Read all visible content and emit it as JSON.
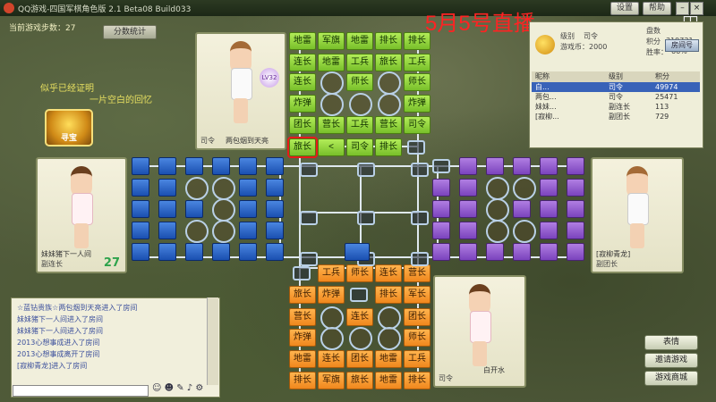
{
  "window": {
    "title": "QQ游戏-四国军棋角色版 2.1 Beta08 Build033",
    "top_buttons": [
      "设置",
      "帮助"
    ]
  },
  "game": {
    "steps_label": "当前游戏步数：27",
    "stats_button": "分数统计"
  },
  "slogan": {
    "line1": "似乎已经证明",
    "line2": "一片空白的回忆"
  },
  "treasure": {
    "label": "寻宝"
  },
  "live_banner": "5月5号直播",
  "players": {
    "top": {
      "name": "两包烟到天亮",
      "rank": "司令",
      "level": "LV32"
    },
    "left": {
      "name": "妹妹猪下一人间",
      "rank": "副连长",
      "gold": "27"
    },
    "right": {
      "name": "[寂柳青龙]",
      "rank": "副团长"
    },
    "bottom": {
      "name": "白开水",
      "rank": "司令"
    }
  },
  "info": {
    "labels": [
      "级别",
      "司令",
      "游戏币：2000"
    ],
    "right_labels": [
      "盘数",
      "积分",
      "胜率："
    ],
    "score": "319731",
    "win_rate": "66%",
    "room_button": "房间号",
    "table": {
      "headers": [
        "昵称",
        "级别",
        "积分"
      ],
      "rows": [
        [
          "白...",
          "司令",
          "49974"
        ],
        [
          "两包...",
          "司令",
          "25471"
        ],
        [
          "妹妹...",
          "副连长",
          "113"
        ],
        [
          "[寂柳...",
          "副团长",
          "729"
        ]
      ]
    }
  },
  "chat": {
    "lines": [
      "☆蓝钻贵族☆两包烟到天亮进入了房间",
      "妹妹猪下一人间进入了房间",
      "妹妹猪下一人间进入了房间",
      "2013心想事成进入了房间",
      "2013心想事成离开了房间",
      "[寂柳青龙]进入了房间"
    ]
  },
  "side_buttons": [
    "表情",
    "邀请游戏",
    "游戏商城"
  ],
  "board": {
    "top_rows": [
      [
        "地雷",
        "军旗",
        "地雷",
        "排长",
        "排长"
      ],
      [
        "连长",
        "地雷",
        "工兵",
        "旅长",
        "工兵"
      ],
      [
        "连长",
        "",
        "师长",
        "",
        "师长"
      ],
      [
        "炸弹",
        "",
        "",
        "",
        "炸弹"
      ],
      [
        "团长",
        "营长",
        "工兵",
        "营长",
        "司令"
      ],
      [
        "旅长",
        "<",
        "司令",
        "排长",
        ""
      ]
    ],
    "bottom_rows": [
      [
        "",
        "工兵",
        "师长",
        "连长",
        "营长"
      ],
      [
        "旅长",
        "炸弹",
        "",
        "排长",
        "军长"
      ],
      [
        "营长",
        "",
        "连长",
        "",
        "团长"
      ],
      [
        "炸弹",
        "",
        "",
        "",
        "师长"
      ],
      [
        "地雷",
        "连长",
        "团长",
        "地雷",
        "工兵"
      ],
      [
        "排长",
        "军旗",
        "旅长",
        "地雷",
        "排长"
      ]
    ]
  }
}
